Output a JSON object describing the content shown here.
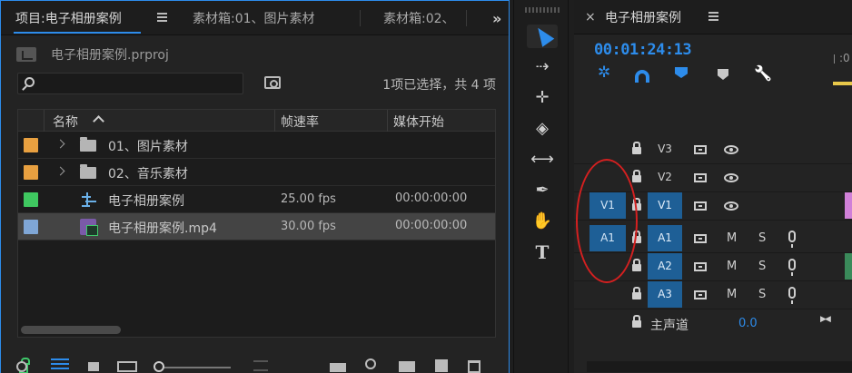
{
  "project": {
    "tabs": [
      {
        "label": "项目:电子相册案例"
      },
      {
        "label": "素材箱:01、图片素材"
      },
      {
        "label": "素材箱:02、"
      }
    ],
    "overflow": "»",
    "file_name": "电子相册案例.prproj",
    "search": {
      "placeholder": ""
    },
    "selection_status": "1项已选择，共 4 项",
    "columns": {
      "name": "名称",
      "fps": "帧速率",
      "media_start": "媒体开始"
    },
    "items": [
      {
        "name": "01、图片素材",
        "type": "bin",
        "fps": "",
        "start": "",
        "color": "#e8a040"
      },
      {
        "name": "02、音乐素材",
        "type": "bin",
        "fps": "",
        "start": "",
        "color": "#e8a040"
      },
      {
        "name": "电子相册案例",
        "type": "sequence",
        "fps": "25.00 fps",
        "start": "00:00:00:00",
        "color": "#3fc860"
      },
      {
        "name": "电子相册案例.mp4",
        "type": "clip",
        "fps": "30.00 fps",
        "start": "00:00:00:00",
        "color": "#7fa6d6"
      }
    ]
  },
  "tools": [
    {
      "name": "selection-tool"
    },
    {
      "name": "track-select-tool"
    },
    {
      "name": "ripple-edit-tool"
    },
    {
      "name": "razor-tool"
    },
    {
      "name": "slip-tool"
    },
    {
      "name": "pen-tool"
    },
    {
      "name": "hand-tool"
    },
    {
      "name": "type-tool"
    }
  ],
  "timeline": {
    "close": "×",
    "title": "电子相册案例",
    "timecode": "00:01:24:13",
    "ruler_mark": ":0",
    "video_tracks": [
      {
        "label": "V3",
        "source": "",
        "targeted": false
      },
      {
        "label": "V2",
        "source": "",
        "targeted": false
      },
      {
        "label": "V1",
        "source": "V1",
        "targeted": true
      }
    ],
    "audio_tracks": [
      {
        "label": "A1",
        "source": "A1",
        "targeted": true,
        "mute": "M",
        "solo": "S"
      },
      {
        "label": "A2",
        "source": "",
        "targeted": true,
        "mute": "M",
        "solo": "S"
      },
      {
        "label": "A3",
        "source": "",
        "targeted": true,
        "mute": "M",
        "solo": "S"
      }
    ],
    "master": {
      "label": "主声道",
      "value": "0.0"
    }
  },
  "colors": {
    "accent": "#2d8ceb",
    "annotation": "#d42020"
  }
}
